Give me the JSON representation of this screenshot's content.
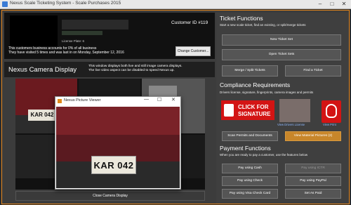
{
  "window": {
    "title": "Nexus Scale Ticketing System - Scale Purchases 2015",
    "min": "–",
    "max": "□",
    "close": "✕"
  },
  "customer": {
    "id_label": "Customer ID #119",
    "license_label": "License Plate: 6",
    "note1": "This customers business accounts for 0% of all business",
    "note2": "They have visited 5 times and was last in on Monday, September 12, 2016",
    "change_button": "Change Customer..."
  },
  "camera": {
    "title": "Nexus Camera Display",
    "desc1": "This window displays both live and still image camera displays.",
    "desc2": "The live video aspect can be disabled to speed Nexus up.",
    "plate_small": "KAR 042",
    "close_button": "Close Camera Display"
  },
  "viewer": {
    "title": "Nexus Picture Viewer",
    "min": "—",
    "max": "☐",
    "close": "✕",
    "plate": "KAR 042"
  },
  "ticket_functions": {
    "title": "Ticket Functions",
    "subtitle": "Start a new scale ticket, find an existing, or split/merge tickets",
    "new": "New Ticket Set",
    "open": "Open Ticket Sets",
    "merge": "Merge / Split Tickets",
    "find": "Find a Ticket"
  },
  "compliance": {
    "title": "Compliance Requirements",
    "subtitle": "Drivers license, signature, fingerprints, camera images and permits",
    "sig_line1": "CLICK FOR",
    "sig_line2": "SIGNATURE",
    "view_scans": "View Drivers License",
    "view_print": "View Print",
    "scan_btn": "Scan Permits and Documents",
    "view_btn": "View Material Pictures (2)"
  },
  "payment": {
    "title": "Payment Functions",
    "subtitle": "When you are ready to pay a customer, use the features below",
    "cash": "Pay using Cash",
    "ictr": "Pay using ICTR",
    "check": "Pay using Check",
    "paypal": "Pay using PayPal",
    "visa": "Pay using Visa Check Card",
    "paid": "Set As Paid"
  }
}
